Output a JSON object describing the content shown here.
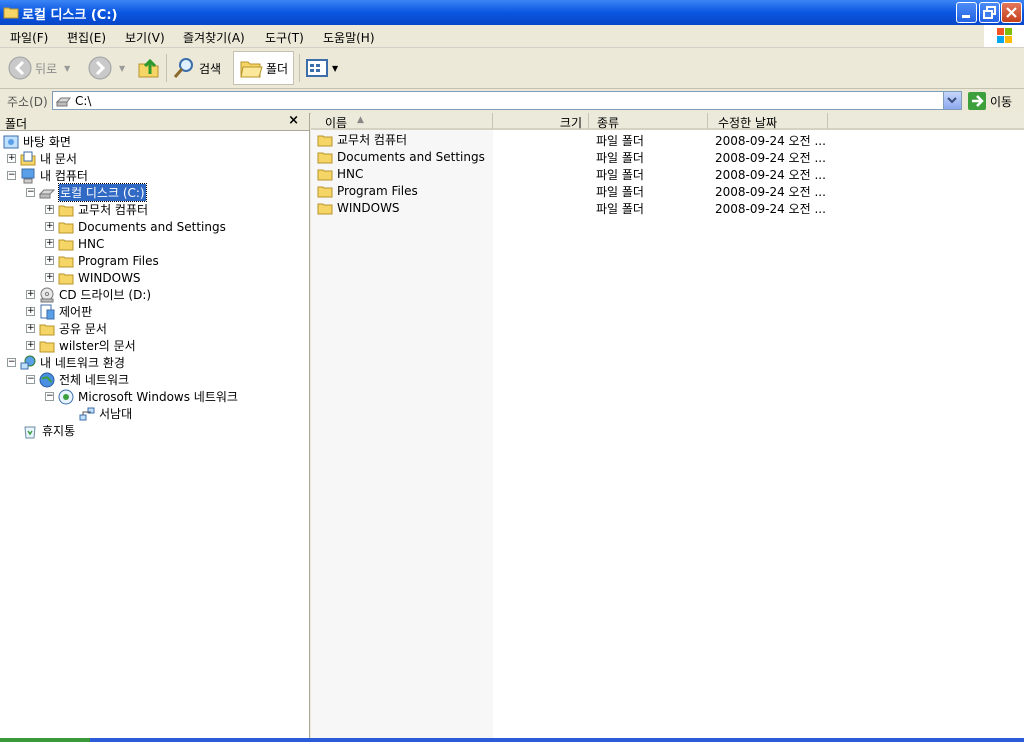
{
  "window": {
    "title": "로컬 디스크 (C:)"
  },
  "menu": [
    {
      "label": "파일(F)"
    },
    {
      "label": "편집(E)"
    },
    {
      "label": "보기(V)"
    },
    {
      "label": "즐겨찾기(A)"
    },
    {
      "label": "도구(T)"
    },
    {
      "label": "도움말(H)"
    }
  ],
  "toolbar": {
    "back": "뒤로",
    "search": "검색",
    "folders": "폴더"
  },
  "address": {
    "label": "주소(D)",
    "value": "C:\\",
    "go": "이동"
  },
  "folderpane": {
    "title": "폴더",
    "close": "×"
  },
  "tree": [
    {
      "label": "바탕 화면"
    },
    {
      "label": "내 문서"
    },
    {
      "label": "내 컴퓨터"
    },
    {
      "label": "로컬 디스크 (C:)"
    },
    {
      "label": "교무처 컴퓨터"
    },
    {
      "label": "Documents and Settings"
    },
    {
      "label": "HNC"
    },
    {
      "label": "Program Files"
    },
    {
      "label": "WINDOWS"
    },
    {
      "label": "CD 드라이브 (D:)"
    },
    {
      "label": "제어판"
    },
    {
      "label": "공유 문서"
    },
    {
      "label": "wilster의 문서"
    },
    {
      "label": "내 네트워크 환경"
    },
    {
      "label": "전체 네트워크"
    },
    {
      "label": "Microsoft Windows 네트워크"
    },
    {
      "label": "서남대"
    },
    {
      "label": "휴지통"
    }
  ],
  "columns": {
    "name": "이름",
    "size": "크기",
    "type": "종류",
    "modified": "수정한 날짜"
  },
  "files": [
    {
      "name": "교무처 컴퓨터",
      "type": "파일 폴더",
      "modified": "2008-09-24 오전 ..."
    },
    {
      "name": "Documents and Settings",
      "type": "파일 폴더",
      "modified": "2008-09-24 오전 ..."
    },
    {
      "name": "HNC",
      "type": "파일 폴더",
      "modified": "2008-09-24 오전 ..."
    },
    {
      "name": "Program Files",
      "type": "파일 폴더",
      "modified": "2008-09-24 오전 ..."
    },
    {
      "name": "WINDOWS",
      "type": "파일 폴더",
      "modified": "2008-09-24 오전 ..."
    }
  ],
  "colors": {
    "titlebar": "#0a56e1",
    "selection": "#316ac5",
    "folder": "#f5d565"
  }
}
